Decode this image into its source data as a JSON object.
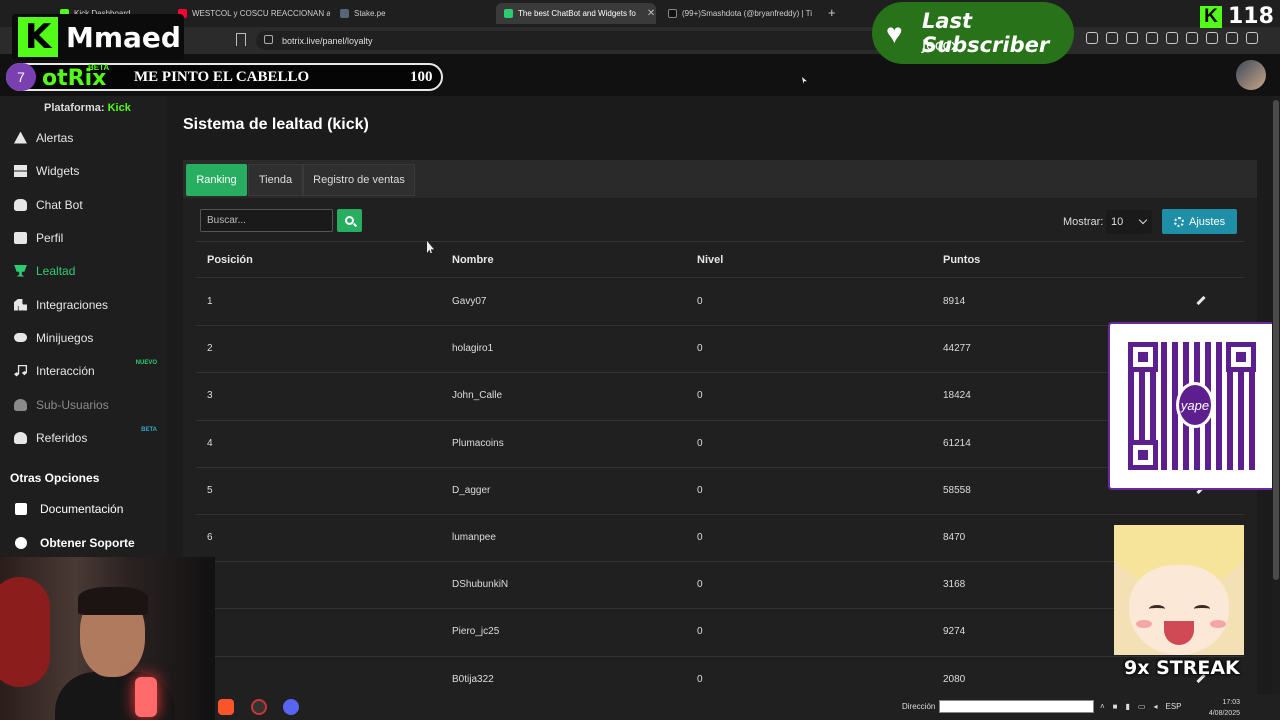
{
  "browser": {
    "tabs": [
      {
        "label": "Kick Dashboard",
        "color": "#53fc18"
      },
      {
        "label": "WESTCOL y COSCU REACCIONAN a",
        "color": "#ff0033"
      },
      {
        "label": "Stake.pe",
        "color": "#556677"
      },
      {
        "label": "The best ChatBot and Widgets fo",
        "color": "#2ecc71"
      },
      {
        "label": "(99+)Smashdota (@bryanfreddy) | Ti",
        "color": "#111111"
      }
    ],
    "url": "botrix.live/panel/loyalty"
  },
  "overlay": {
    "kick_name": "Mmaed",
    "last_sub_title": "Last Subscriber",
    "last_sub_name": "Jecox",
    "viewer_count": "118",
    "goal_badge": "7",
    "goal_text": "ME PINTO EL CABELLO",
    "goal_value": "100",
    "streak": "9x STREAK",
    "qr_logo": "yape"
  },
  "app": {
    "brand": "otRix",
    "brand_tag": "BETA",
    "platform_label": "Plataforma:",
    "platform_value": "Kick"
  },
  "sidebar": {
    "items": [
      {
        "label": "Alertas",
        "icon": "warning-icon"
      },
      {
        "label": "Widgets",
        "icon": "widgets-icon"
      },
      {
        "label": "Chat Bot",
        "icon": "robot-icon"
      },
      {
        "label": "Perfil",
        "icon": "id-card-icon"
      },
      {
        "label": "Lealtad",
        "icon": "trophy-icon"
      },
      {
        "label": "Integraciones",
        "icon": "integrations-icon"
      },
      {
        "label": "Minijuegos",
        "icon": "gamepad-icon"
      },
      {
        "label": "Interacción",
        "icon": "music-icon",
        "tag": "NUEVO"
      },
      {
        "label": "Sub-Usuarios",
        "icon": "users-icon"
      },
      {
        "label": "Referidos",
        "icon": "referrals-icon",
        "tag": "BETA"
      }
    ],
    "other_title": "Otras Opciones",
    "other_items": [
      {
        "label": "Documentación",
        "icon": "book-icon"
      },
      {
        "label": "Obtener Soporte",
        "icon": "help-icon"
      }
    ]
  },
  "main": {
    "title": "Sistema de lealtad (kick)",
    "tabs": [
      "Ranking",
      "Tienda",
      "Registro de ventas"
    ],
    "search_placeholder": "Buscar...",
    "show_label": "Mostrar:",
    "show_value": "10",
    "settings_label": "Ajustes",
    "columns": [
      "Posición",
      "Nombre",
      "Nivel",
      "Puntos"
    ],
    "rows": [
      {
        "pos": "1",
        "name": "Gavy07",
        "level": "0",
        "points": "8914"
      },
      {
        "pos": "2",
        "name": "holagiro1",
        "level": "0",
        "points": "44277"
      },
      {
        "pos": "3",
        "name": "John_Calle",
        "level": "0",
        "points": "18424"
      },
      {
        "pos": "4",
        "name": "Plumacoins",
        "level": "0",
        "points": "61214"
      },
      {
        "pos": "5",
        "name": "D_agger",
        "level": "0",
        "points": "58558"
      },
      {
        "pos": "6",
        "name": "lumanpee",
        "level": "0",
        "points": "8470"
      },
      {
        "pos": "",
        "name": "DShubunkiN",
        "level": "0",
        "points": "3168"
      },
      {
        "pos": "",
        "name": "Piero_jc25",
        "level": "0",
        "points": "9274"
      },
      {
        "pos": "",
        "name": "B0tija322",
        "level": "0",
        "points": "2080"
      }
    ]
  },
  "taskbar": {
    "address_label": "Dirección",
    "lang": "ESP",
    "time": "17:03",
    "date": "4/08/2025"
  }
}
